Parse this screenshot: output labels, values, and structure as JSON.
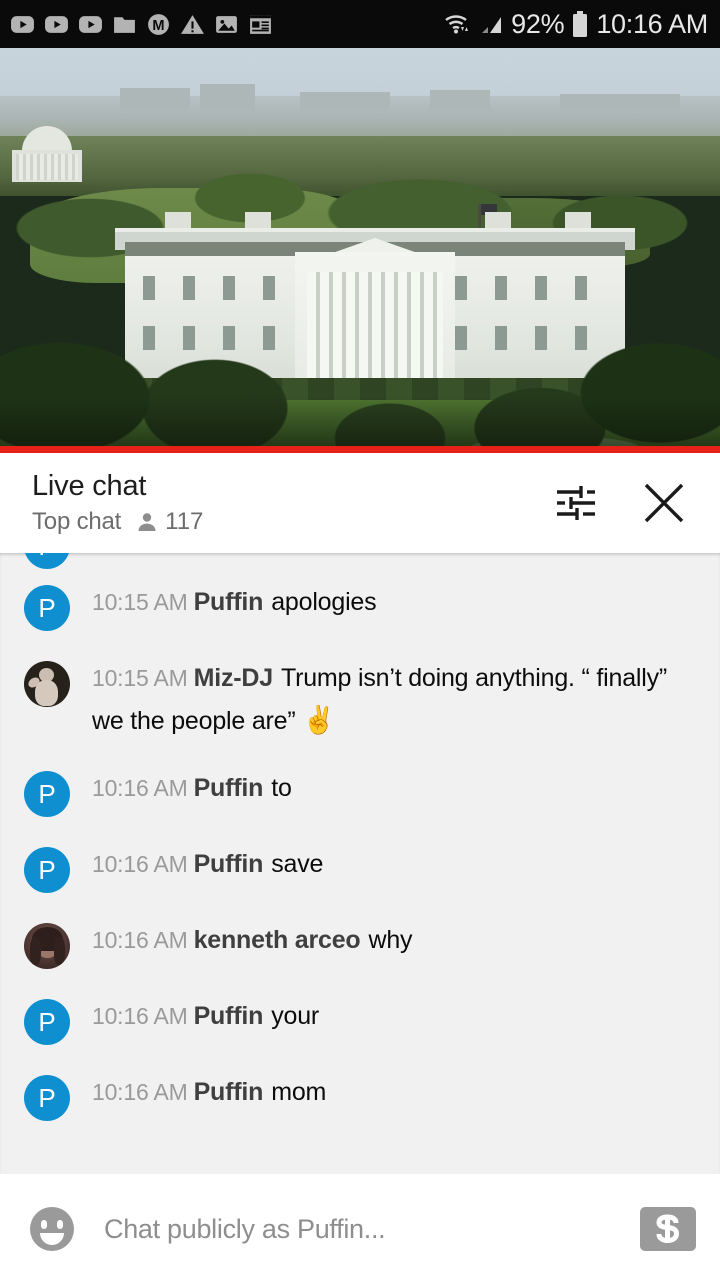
{
  "status_bar": {
    "left_icons": [
      "youtube-play-icon",
      "youtube-play-icon",
      "youtube-play-icon",
      "folder-icon",
      "m-circle-icon",
      "warning-triangle-icon",
      "image-icon",
      "news-article-icon"
    ],
    "wifi_icon": "wifi-icon",
    "signal_icon": "cellular-signal-icon",
    "battery_percent": "92%",
    "battery_icon": "battery-icon",
    "clock": "10:16 AM"
  },
  "player": {
    "scene_description": "White House live stream",
    "progress_percent": 100,
    "progress_color": "#e62117"
  },
  "chat_header": {
    "title": "Live chat",
    "subtitle": "Top chat",
    "viewer_icon": "person-icon",
    "viewer_count": "117",
    "settings_icon": "tune-sliders-icon",
    "close_icon": "close-icon"
  },
  "messages": [
    {
      "avatar_type": "letter",
      "avatar_letter": "P",
      "timestamp": "",
      "author": "",
      "text": "",
      "partial": true
    },
    {
      "avatar_type": "letter",
      "avatar_letter": "P",
      "timestamp": "10:15 AM",
      "author": "Puffin",
      "text": "apologies"
    },
    {
      "avatar_type": "bear",
      "avatar_letter": "",
      "timestamp": "10:15 AM",
      "author": "Miz-DJ",
      "text": "Trump isn’t doing anything. “ finally” we the people are” ",
      "emoji": "✌️"
    },
    {
      "avatar_type": "letter",
      "avatar_letter": "P",
      "timestamp": "10:16 AM",
      "author": "Puffin",
      "text": "to"
    },
    {
      "avatar_type": "letter",
      "avatar_letter": "P",
      "timestamp": "10:16 AM",
      "author": "Puffin",
      "text": "save"
    },
    {
      "avatar_type": "person",
      "avatar_letter": "",
      "timestamp": "10:16 AM",
      "author": "kenneth arceo",
      "text": "why"
    },
    {
      "avatar_type": "letter",
      "avatar_letter": "P",
      "timestamp": "10:16 AM",
      "author": "Puffin",
      "text": "your"
    },
    {
      "avatar_type": "letter",
      "avatar_letter": "P",
      "timestamp": "10:16 AM",
      "author": "Puffin",
      "text": "mom"
    }
  ],
  "input_bar": {
    "emoji_icon": "emoji-smiley-icon",
    "placeholder": "Chat publicly as Puffin...",
    "value": "",
    "superchat_icon": "dollar-superchat-icon"
  },
  "colors": {
    "avatar_blue": "#0f8fd0",
    "chat_background": "#f1f1f1",
    "progress_red": "#e62117",
    "status_bar_background": "#0a0a0a"
  }
}
